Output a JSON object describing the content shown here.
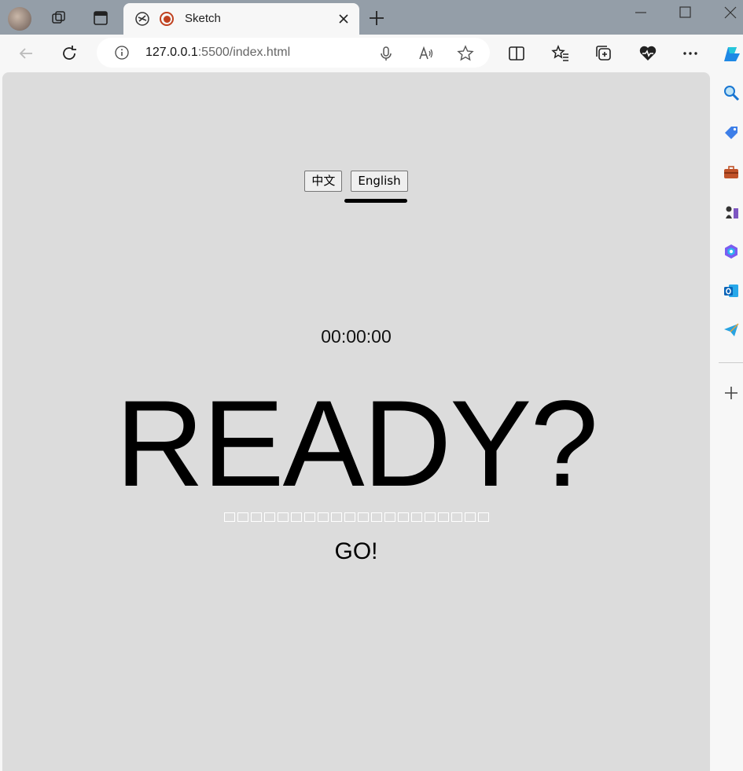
{
  "browser": {
    "tab_title": "Sketch",
    "url_host": "127.0.0.1",
    "url_rest": ":5500/index.html"
  },
  "page": {
    "lang_buttons": [
      "中文",
      "English"
    ],
    "active_lang": "English",
    "timer": "00:00:00",
    "headline": "READY?",
    "placeholder_box_count": 20,
    "action": "GO!"
  },
  "colors": {
    "page_background": "#dcdcdc",
    "tabstrip": "#949ea8"
  }
}
